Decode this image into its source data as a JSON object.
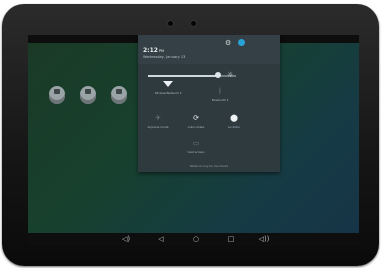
{
  "status": {
    "time": "2:12",
    "ampm": "PM",
    "date": "Wednesday, January 13"
  },
  "brightness": {
    "level": 0.78
  },
  "tiles": [
    {
      "label": "WirelessNetwork",
      "arrow": "▾",
      "icon": "wifi-icon"
    },
    {
      "label": "Bluetooth",
      "arrow": "▾",
      "icon": "bluetooth-icon"
    },
    {
      "label": "Airplane mode",
      "icon": "airplane-icon"
    },
    {
      "label": "Auto-rotate",
      "icon": "rotate-icon"
    },
    {
      "label": "Location",
      "icon": "location-icon"
    },
    {
      "label": "Cast screen",
      "icon": "cast-icon"
    }
  ],
  "footer": {
    "note": "Network may be monitored"
  },
  "nav": {
    "volume_down": "◁)",
    "back": "◁",
    "home": "○",
    "recents": "□",
    "volume_up": "◁))"
  },
  "colors": {
    "shade": "#2f3a3f",
    "accent": "#29a3d6"
  }
}
